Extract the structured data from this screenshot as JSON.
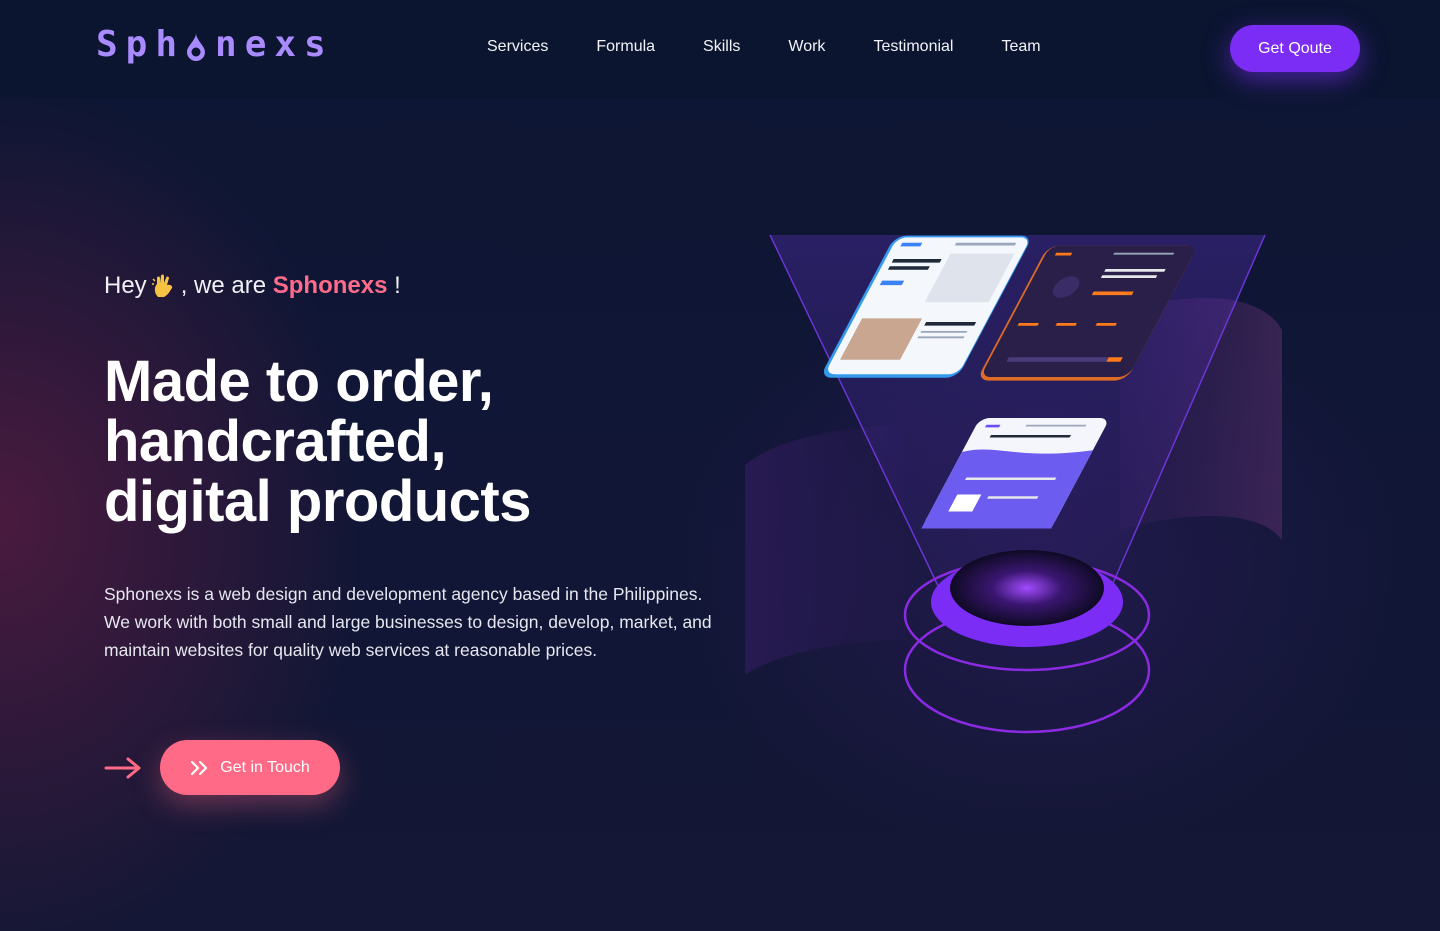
{
  "header": {
    "logo_text": "Sph nexs",
    "logo_prefix": "Sph",
    "logo_suffix": "nexs",
    "nav": [
      "Services",
      "Formula",
      "Skills",
      "Work",
      "Testimonial",
      "Team"
    ],
    "quote_label": "Get Qoute"
  },
  "hero": {
    "intro_prefix": "Hey",
    "intro_middle": ", we are",
    "intro_brand": "Sphonexs",
    "intro_suffix": "!",
    "title_lines": [
      "Made to order,",
      "handcrafted,",
      "digital products"
    ],
    "description": "Sphonexs is a web design and development agency based in the Philippines. We work with both small and large businesses to design, develop, market, and maintain websites for quality web services at reasonable prices.",
    "cta_label": "Get in Touch"
  },
  "icons": {
    "logo_drop": "drop-icon",
    "wave_hand": "hand-icon",
    "cta_arrow": "arrow-right-icon",
    "cta_chevrons": "double-chevron-icon"
  },
  "colors": {
    "background": "#0c1633",
    "accent_purple": "#7b2cf5",
    "logo_purple": "#a98bff",
    "accent_pink": "#ff6b86",
    "brand_pink": "#ff6b8b"
  }
}
